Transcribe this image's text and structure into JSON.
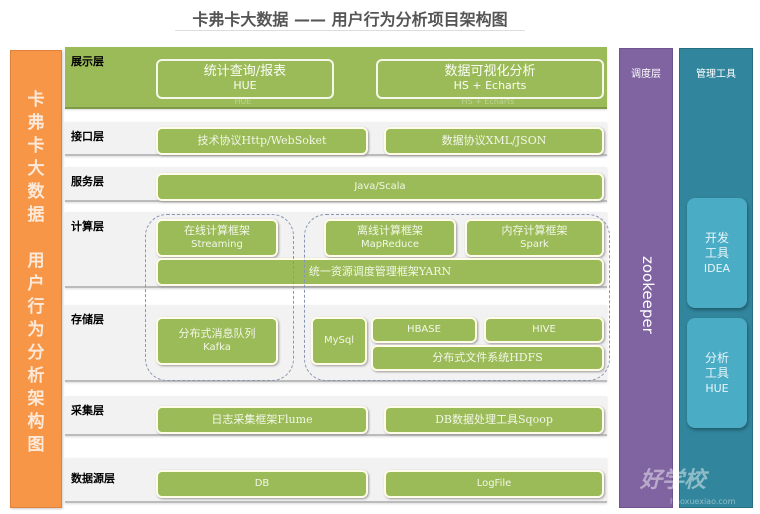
{
  "title": "卡弗卡大数据 —— 用户行为分析项目架构图",
  "left_panel": {
    "chars": [
      "卡",
      "弗",
      "卡",
      "大",
      "数",
      "据",
      "",
      "用",
      "户",
      "行",
      "为",
      "分",
      "析",
      "架",
      "构",
      "图"
    ]
  },
  "layers": {
    "display": {
      "label": "展示层",
      "boxes": [
        {
          "cn": "统计查询/报表",
          "en": "HUE"
        },
        {
          "cn": "数据可视化分析",
          "en": "HS + Echarts"
        }
      ]
    },
    "interface": {
      "label": "接口层",
      "boxes": [
        {
          "text": "技术协议Http/WebSoket"
        },
        {
          "text": "数据协议XML/JSON"
        }
      ]
    },
    "service": {
      "label": "服务层",
      "boxes": [
        {
          "text": "Java/Scala"
        }
      ]
    },
    "compute": {
      "label": "计算层",
      "boxes": [
        {
          "cn": "在线计算框架",
          "en": "Streaming"
        },
        {
          "cn": "离线计算框架",
          "en": "MapReduce"
        },
        {
          "cn": "内存计算框架",
          "en": "Spark"
        },
        {
          "text": "统一资源调度管理框架YARN"
        }
      ]
    },
    "storage": {
      "label": "存储层",
      "boxes": [
        {
          "cn": "分布式消息队列",
          "en": "Kafka"
        },
        {
          "text": "MySql"
        },
        {
          "text": "HBASE"
        },
        {
          "text": "HIVE"
        },
        {
          "text": "分布式文件系统HDFS"
        }
      ]
    },
    "collect": {
      "label": "采集层",
      "boxes": [
        {
          "text": "日志采集框架Flume"
        },
        {
          "text": "DB数据处理工具Sqoop"
        }
      ]
    },
    "source": {
      "label": "数据源层",
      "boxes": [
        {
          "text": "DB"
        },
        {
          "text": "LogFile"
        }
      ]
    }
  },
  "scheduler": {
    "title": "调度层",
    "tool": "zookeeper"
  },
  "management": {
    "title": "管理工具",
    "tools": [
      {
        "line1": "开发",
        "line2": "工具",
        "line3": "IDEA"
      },
      {
        "line1": "分析",
        "line2": "工具",
        "line3": "HUE"
      }
    ]
  },
  "watermark": {
    "text": "好学校",
    "sub": "haoxuexiao.com"
  },
  "colors": {
    "orange": "#f79646",
    "green": "#9bbb59",
    "purple": "#8064a2",
    "teal": "#31859c",
    "tool_blue": "#4bacc6"
  }
}
